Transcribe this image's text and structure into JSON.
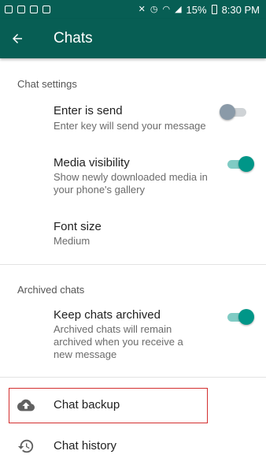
{
  "status_bar": {
    "battery_percent": "15%",
    "time": "8:30 PM"
  },
  "app_bar": {
    "title": "Chats"
  },
  "sections": {
    "chat_settings": {
      "header": "Chat settings",
      "enter_is_send": {
        "title": "Enter is send",
        "subtitle": "Enter key will send your message",
        "enabled": false
      },
      "media_visibility": {
        "title": "Media visibility",
        "subtitle": "Show newly downloaded media in your phone's gallery",
        "enabled": true
      },
      "font_size": {
        "title": "Font size",
        "value": "Medium"
      }
    },
    "archived_chats": {
      "header": "Archived chats",
      "keep_archived": {
        "title": "Keep chats archived",
        "subtitle": "Archived chats will remain archived when you receive a new message",
        "enabled": true
      }
    },
    "chat_backup": {
      "title": "Chat backup",
      "icon": "cloud-upload-icon"
    },
    "chat_history": {
      "title": "Chat history",
      "icon": "history-icon"
    }
  },
  "colors": {
    "primary": "#075e54",
    "accent": "#009688",
    "highlight_border": "#d32f2f"
  }
}
